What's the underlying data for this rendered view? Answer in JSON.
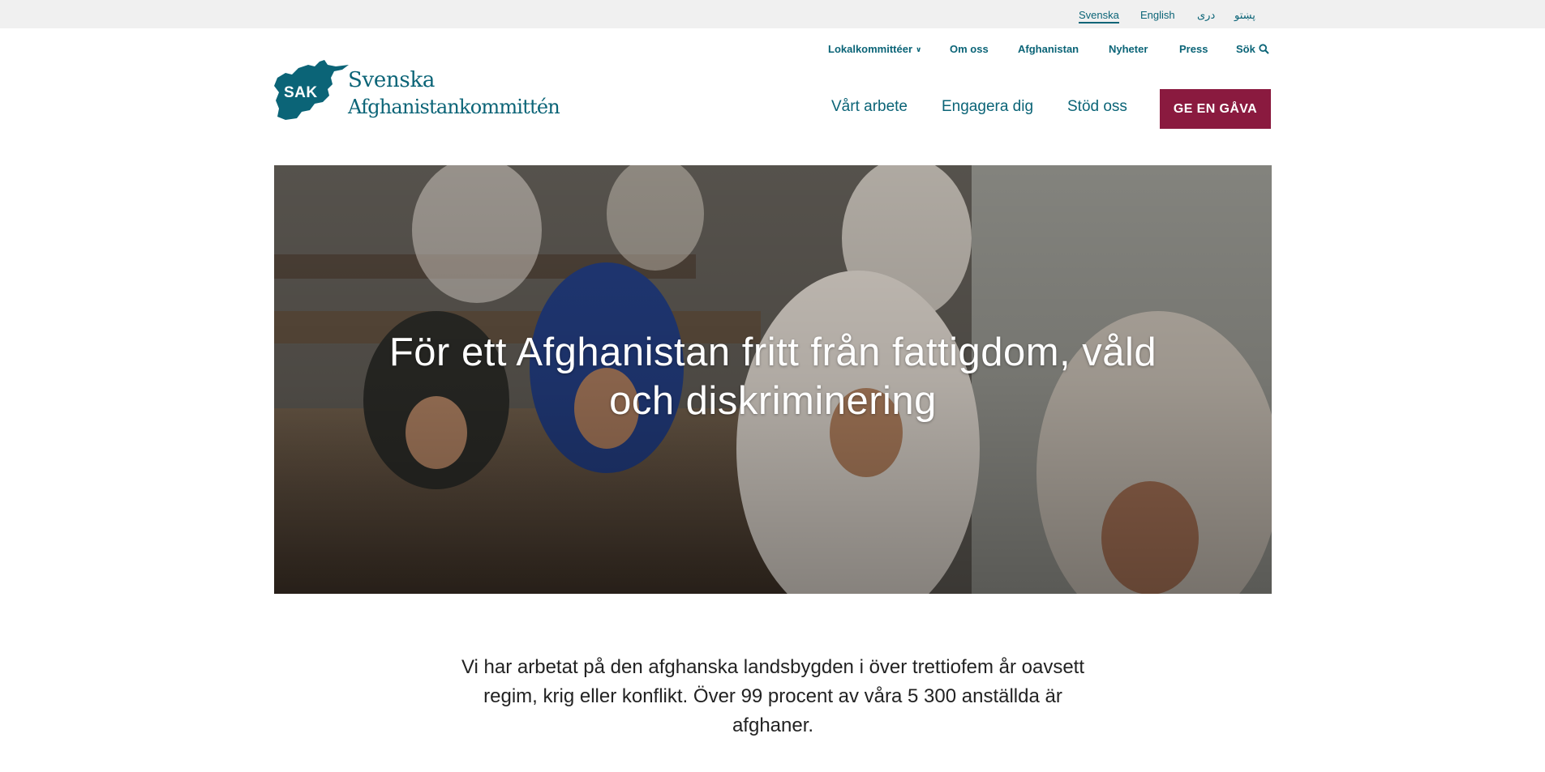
{
  "languages": [
    {
      "label": "Svenska",
      "active": true
    },
    {
      "label": "English",
      "active": false
    },
    {
      "label": "دری",
      "active": false
    },
    {
      "label": "پښتو",
      "active": false
    }
  ],
  "utility_nav": {
    "local_committees": "Lokalkommittéer",
    "about": "Om oss",
    "afghanistan": "Afghanistan",
    "news": "Nyheter",
    "press": "Press",
    "search": "Sök"
  },
  "logo": {
    "abbr": "SAK",
    "line1": "Svenska",
    "line2": "Afghanistankommittén"
  },
  "main_nav": {
    "our_work": "Vårt arbete",
    "engage": "Engagera dig",
    "support": "Stöd oss",
    "donate": "GE EN GÅVA"
  },
  "hero": {
    "title_line1": "För ett Afghanistan fritt från fattigdom, våld",
    "title_line2": "och diskriminering"
  },
  "intro": {
    "line1": "Vi har arbetat på den afghanska landsbygden i över trettiofem år oavsett",
    "line2": "regim, krig eller konflikt. Över 99 procent av våra 5 300 anställda är",
    "line3": "afghaner."
  },
  "colors": {
    "brand_teal": "#0b6477",
    "donate_red": "#8a1a3f",
    "lang_bar_bg": "#f0f0f0"
  }
}
